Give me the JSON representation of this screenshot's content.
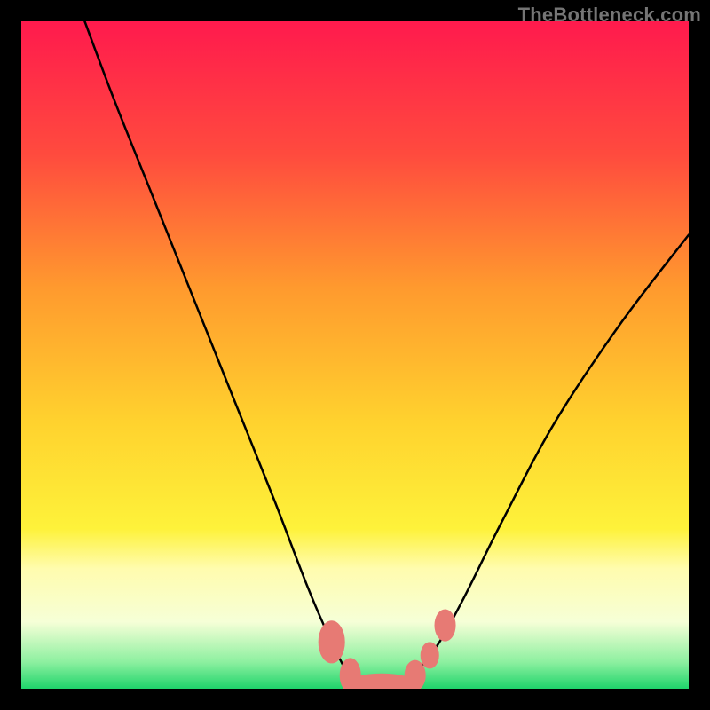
{
  "watermark": "TheBottleneck.com",
  "chart_data": {
    "type": "line",
    "title": "",
    "xlabel": "",
    "ylabel": "",
    "xlim": [
      0,
      100
    ],
    "ylim": [
      0,
      100
    ],
    "grid": false,
    "legend": false,
    "background": {
      "type": "vertical-gradient",
      "stops": [
        {
          "pos": 0.0,
          "color": "#ff1a4d"
        },
        {
          "pos": 0.2,
          "color": "#ff4b3e"
        },
        {
          "pos": 0.4,
          "color": "#ff9a2e"
        },
        {
          "pos": 0.6,
          "color": "#ffd22e"
        },
        {
          "pos": 0.76,
          "color": "#fef23a"
        },
        {
          "pos": 0.82,
          "color": "#fffcae"
        },
        {
          "pos": 0.9,
          "color": "#f6ffd7"
        },
        {
          "pos": 0.96,
          "color": "#8df0a0"
        },
        {
          "pos": 1.0,
          "color": "#1fd46b"
        }
      ]
    },
    "series": [
      {
        "name": "bottleneck-curve",
        "x": [
          9.5,
          14,
          20,
          26,
          32,
          38,
          43,
          46.5,
          49.5,
          52,
          55,
          58,
          62,
          66,
          72,
          80,
          90,
          100
        ],
        "y": [
          100,
          88,
          73,
          58,
          43,
          28,
          15,
          7,
          1.5,
          0.5,
          0.5,
          1.5,
          6,
          13,
          25,
          40,
          55,
          68
        ]
      }
    ],
    "markers": [
      {
        "shape": "pill",
        "x": 46.5,
        "y": 7,
        "rx": 2.0,
        "ry": 3.2,
        "angle": 0,
        "color": "#e77a74"
      },
      {
        "shape": "pill",
        "x": 49.3,
        "y": 2.0,
        "rx": 1.6,
        "ry": 2.6,
        "angle": 0,
        "color": "#e77a74"
      },
      {
        "shape": "pill",
        "x": 54.0,
        "y": 0.5,
        "rx": 5.5,
        "ry": 1.8,
        "angle": 0,
        "color": "#e77a74"
      },
      {
        "shape": "pill",
        "x": 59.0,
        "y": 2.0,
        "rx": 1.6,
        "ry": 2.3,
        "angle": 0,
        "color": "#e77a74"
      },
      {
        "shape": "pill",
        "x": 61.2,
        "y": 5.0,
        "rx": 1.4,
        "ry": 2.0,
        "angle": 0,
        "color": "#e77a74"
      },
      {
        "shape": "pill",
        "x": 63.5,
        "y": 9.5,
        "rx": 1.6,
        "ry": 2.4,
        "angle": 0,
        "color": "#e77a74"
      }
    ]
  }
}
